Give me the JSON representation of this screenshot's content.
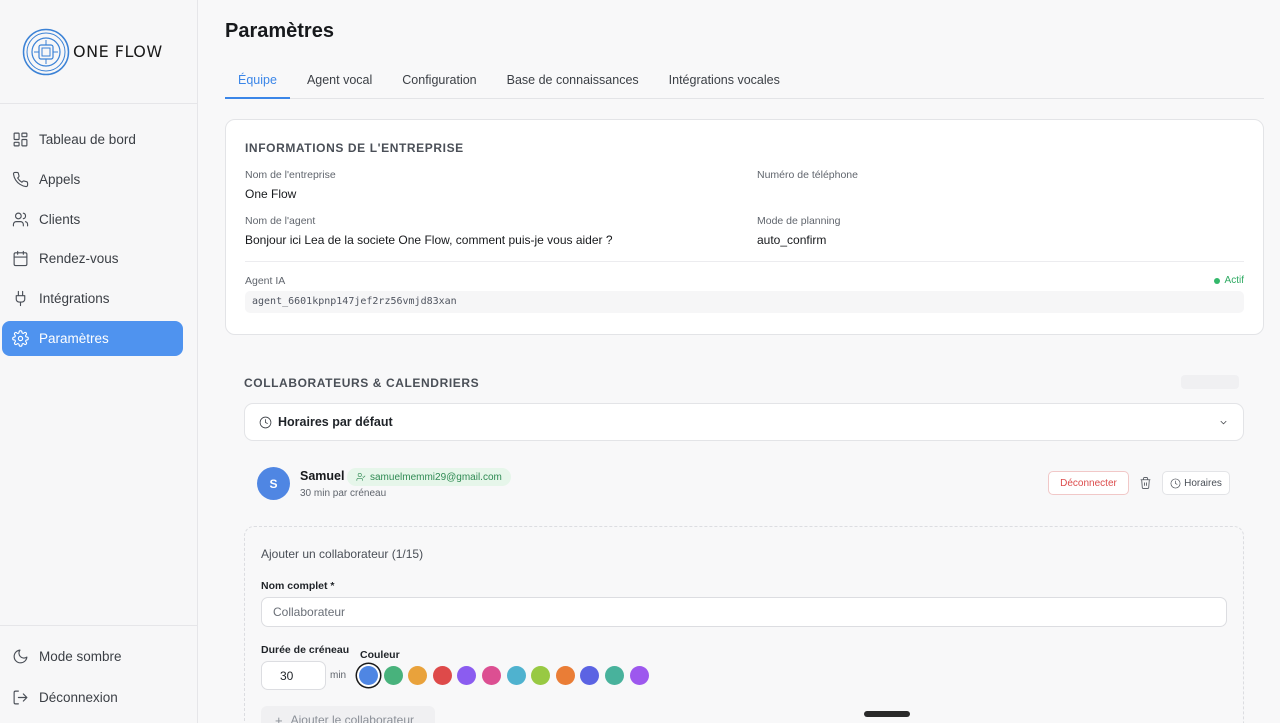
{
  "brand": {
    "name": "ONE FLOW"
  },
  "sidebar": {
    "items": [
      {
        "label": "Tableau de bord",
        "icon": "dashboard-icon"
      },
      {
        "label": "Appels",
        "icon": "phone-icon"
      },
      {
        "label": "Clients",
        "icon": "users-icon"
      },
      {
        "label": "Rendez-vous",
        "icon": "calendar-icon"
      },
      {
        "label": "Intégrations",
        "icon": "plug-icon"
      },
      {
        "label": "Paramètres",
        "icon": "gear-icon",
        "active": true
      }
    ],
    "bottom": [
      {
        "label": "Mode sombre",
        "icon": "moon-icon"
      },
      {
        "label": "Déconnexion",
        "icon": "logout-icon"
      }
    ]
  },
  "page": {
    "title": "Paramètres"
  },
  "tabs": [
    {
      "label": "Équipe",
      "active": true
    },
    {
      "label": "Agent vocal"
    },
    {
      "label": "Configuration"
    },
    {
      "label": "Base de connaissances"
    },
    {
      "label": "Intégrations vocales"
    }
  ],
  "company": {
    "section_title": "INFORMATIONS DE L'ENTREPRISE",
    "name_label": "Nom de l'entreprise",
    "name_value": "One Flow",
    "phone_label": "Numéro de téléphone",
    "phone_value": "",
    "agent_label": "Nom de l'agent",
    "agent_value": "Bonjour ici Lea de la societe One Flow, comment puis-je vous aider ?",
    "planning_label": "Mode de planning",
    "planning_value": "auto_confirm",
    "ai_label": "Agent IA",
    "ai_status": "Actif",
    "ai_id": "agent_6601kpnp147jef2rz56vmjd83xan"
  },
  "collaborators": {
    "section_title": "COLLABORATEURS & CALENDRIERS",
    "default_hours_label": "Horaires par défaut",
    "member": {
      "initial": "S",
      "name": "Samuel",
      "email": "samuelmemmi29@gmail.com",
      "slot": "30 min par créneau",
      "disconnect_label": "Déconnecter",
      "hours_label": "Horaires"
    },
    "add": {
      "title": "Ajouter un collaborateur (1/15)",
      "name_label": "Nom complet *",
      "name_placeholder": "Collaborateur",
      "duration_label": "Durée de créneau",
      "duration_value": "30",
      "duration_unit": "min",
      "color_label": "Couleur",
      "colors": [
        "#4f86e3",
        "#48b27c",
        "#e9a23b",
        "#de4a4a",
        "#8b5cf0",
        "#dc4f92",
        "#4fb2cf",
        "#98c943",
        "#ea7d36",
        "#5b63e3",
        "#48b29c",
        "#9d58ee"
      ],
      "selected_color_index": 0,
      "add_button_label": "Ajouter le collaborateur"
    }
  },
  "colors": {
    "accent": "#4f93ef",
    "status_active": "#33b86b",
    "danger": "#dc4b4b"
  }
}
